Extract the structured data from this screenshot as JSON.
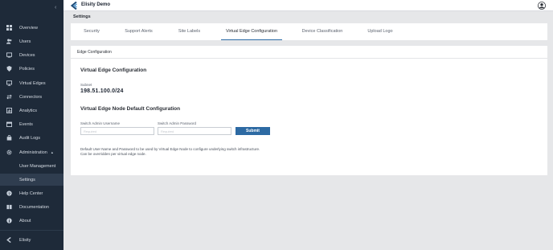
{
  "app": {
    "name": "Elisity Demo"
  },
  "sidebar": {
    "items": [
      {
        "label": "Overview",
        "icon": "grid-icon"
      },
      {
        "label": "Users",
        "icon": "users-icon"
      },
      {
        "label": "Devices",
        "icon": "devices-icon"
      },
      {
        "label": "Policies",
        "icon": "shield-icon"
      },
      {
        "label": "Virtual Edges",
        "icon": "monitor-icon"
      },
      {
        "label": "Connectors",
        "icon": "arrows-icon"
      },
      {
        "label": "Analytics",
        "icon": "chart-icon"
      },
      {
        "label": "Events",
        "icon": "calendar-icon"
      },
      {
        "label": "Audit Logs",
        "icon": "bag-icon"
      },
      {
        "label": "Administration",
        "icon": "gear-icon"
      },
      {
        "label": "User Management"
      },
      {
        "label": "Settings"
      },
      {
        "label": "Help Center",
        "icon": "help-icon"
      },
      {
        "label": "Documentation",
        "icon": "book-icon"
      },
      {
        "label": "About",
        "icon": "info-icon"
      },
      {
        "label": "Elisity",
        "icon": "elisity-logo-icon"
      }
    ]
  },
  "page": {
    "title": "Settings"
  },
  "tabs": [
    {
      "label": "Security"
    },
    {
      "label": "Support Alerts"
    },
    {
      "label": "Site Labels"
    },
    {
      "label": "Virtual Edge Configuration"
    },
    {
      "label": "Device Classification"
    },
    {
      "label": "Upload Logo"
    }
  ],
  "content": {
    "header": "Edge Configuration",
    "section_title": "Virtual Edge Configuration",
    "subnet_label": "Subnet",
    "subnet_value": "198.51.100.0/24",
    "node_section_title": "Virtual Edge Node Default Configuration",
    "username_label": "Switch Admin Username",
    "username_placeholder": "Required",
    "password_label": "Switch Admin Password",
    "password_placeholder": "Required",
    "submit_label": "Submit",
    "help_text": "Default User Name and Password to be used by Virtual Edge Node to configure underlying switch infrastructure. Can be overridden per virtual edge node."
  },
  "colors": {
    "sidebar_bg": "#1e2a39",
    "accent": "#2d6aa3",
    "page_bg": "#e6e7e9"
  }
}
